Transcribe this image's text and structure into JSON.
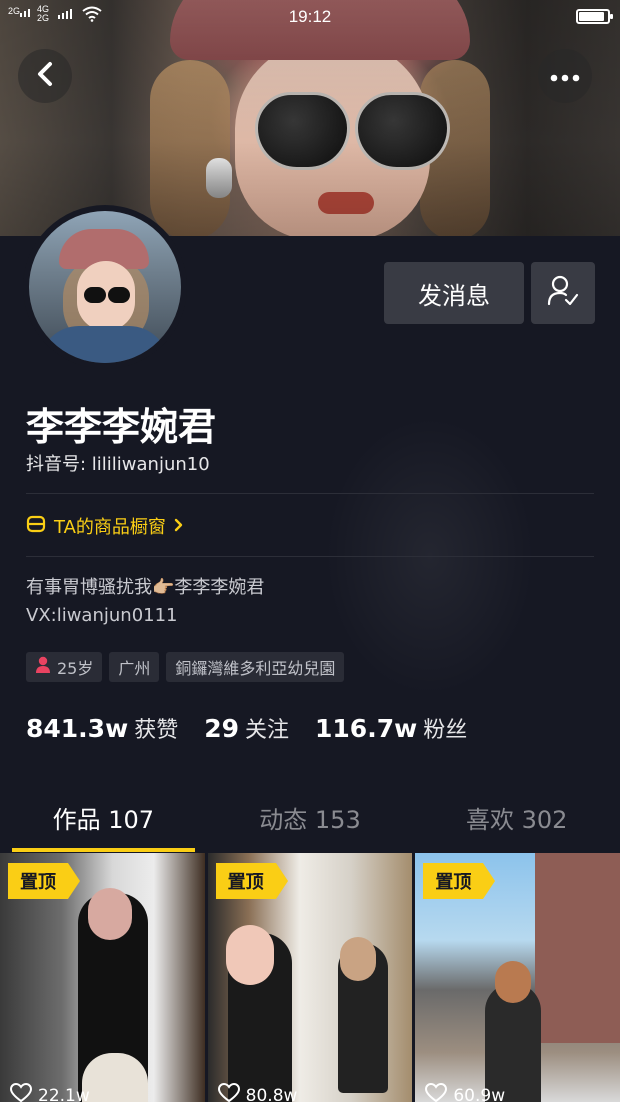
{
  "status_bar": {
    "sig1": "2G",
    "sig2_top": "4G",
    "sig2_bottom": "2G",
    "time": "19:12",
    "battery_level": 0.9
  },
  "header": {
    "back_icon": "chevron-left-icon",
    "more_icon": "more-horizontal-icon"
  },
  "profile": {
    "name": "李李李婉君",
    "uid_label": "抖音号: ",
    "uid": "lililiwanjun10",
    "send_message_label": "发消息",
    "follow_icon": "user-check-icon",
    "shop_label": "TA的商品橱窗",
    "bio_line1": "有事胃博骚扰我👉🏼李李李婉君",
    "bio_line2": "VX:liwanjun0111",
    "tags": {
      "age": "25岁",
      "city": "广州",
      "school": "銅鑼灣維多利亞幼兒園"
    }
  },
  "stats": {
    "likes_value": "841.3w",
    "likes_label": "获赞",
    "following_value": "29",
    "following_label": "关注",
    "followers_value": "116.7w",
    "followers_label": "粉丝"
  },
  "tabs": [
    {
      "label": "作品 107"
    },
    {
      "label": "动态 153"
    },
    {
      "label": "喜欢 302"
    }
  ],
  "videos": [
    {
      "pin": "置顶",
      "likes": "22.1w"
    },
    {
      "pin": "置顶",
      "likes": "80.8w"
    },
    {
      "pin": "置顶",
      "likes": "60.9w"
    }
  ],
  "colors": {
    "background": "#161823",
    "accent": "#face15",
    "button_bg": "#393b44"
  }
}
